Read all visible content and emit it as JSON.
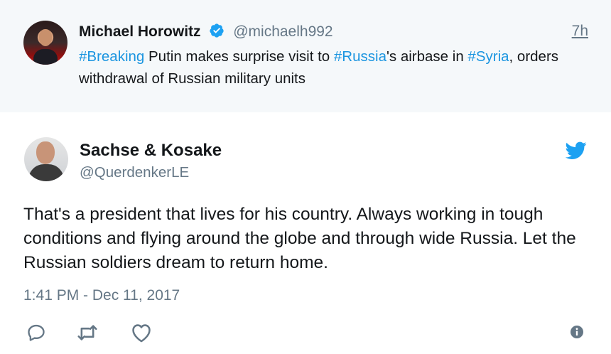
{
  "parent_tweet": {
    "name": "Michael Horowitz",
    "handle": "@michaelh992",
    "time": "7h",
    "text_segments": [
      {
        "text": "#Breaking",
        "type": "hashtag"
      },
      {
        "text": " Putin makes surprise visit to ",
        "type": "text"
      },
      {
        "text": "#Russia",
        "type": "hashtag"
      },
      {
        "text": "'s airbase in ",
        "type": "text"
      },
      {
        "text": "#Syria",
        "type": "hashtag"
      },
      {
        "text": ", orders withdrawal of Russian military units",
        "type": "text"
      }
    ],
    "icons": {
      "verified": "verified-badge-icon"
    }
  },
  "reply_tweet": {
    "name": "Sachse & Kosake",
    "handle": "@QuerdenkerLE",
    "text": "That's a president that lives for his country. Always working in tough conditions and flying around the globe and through wide Russia. Let the Russian soldiers dream to return home.",
    "date": "1:41 PM - Dec 11, 2017",
    "icons": {
      "brand": "twitter-bird-icon",
      "reply": "reply-icon",
      "retweet": "retweet-icon",
      "like": "heart-icon",
      "info": "info-icon"
    }
  },
  "colors": {
    "link": "#1b95e0",
    "muted": "#657786",
    "text": "#14171a",
    "parent_bg": "#f5f8fa",
    "brand": "#1da1f2"
  }
}
